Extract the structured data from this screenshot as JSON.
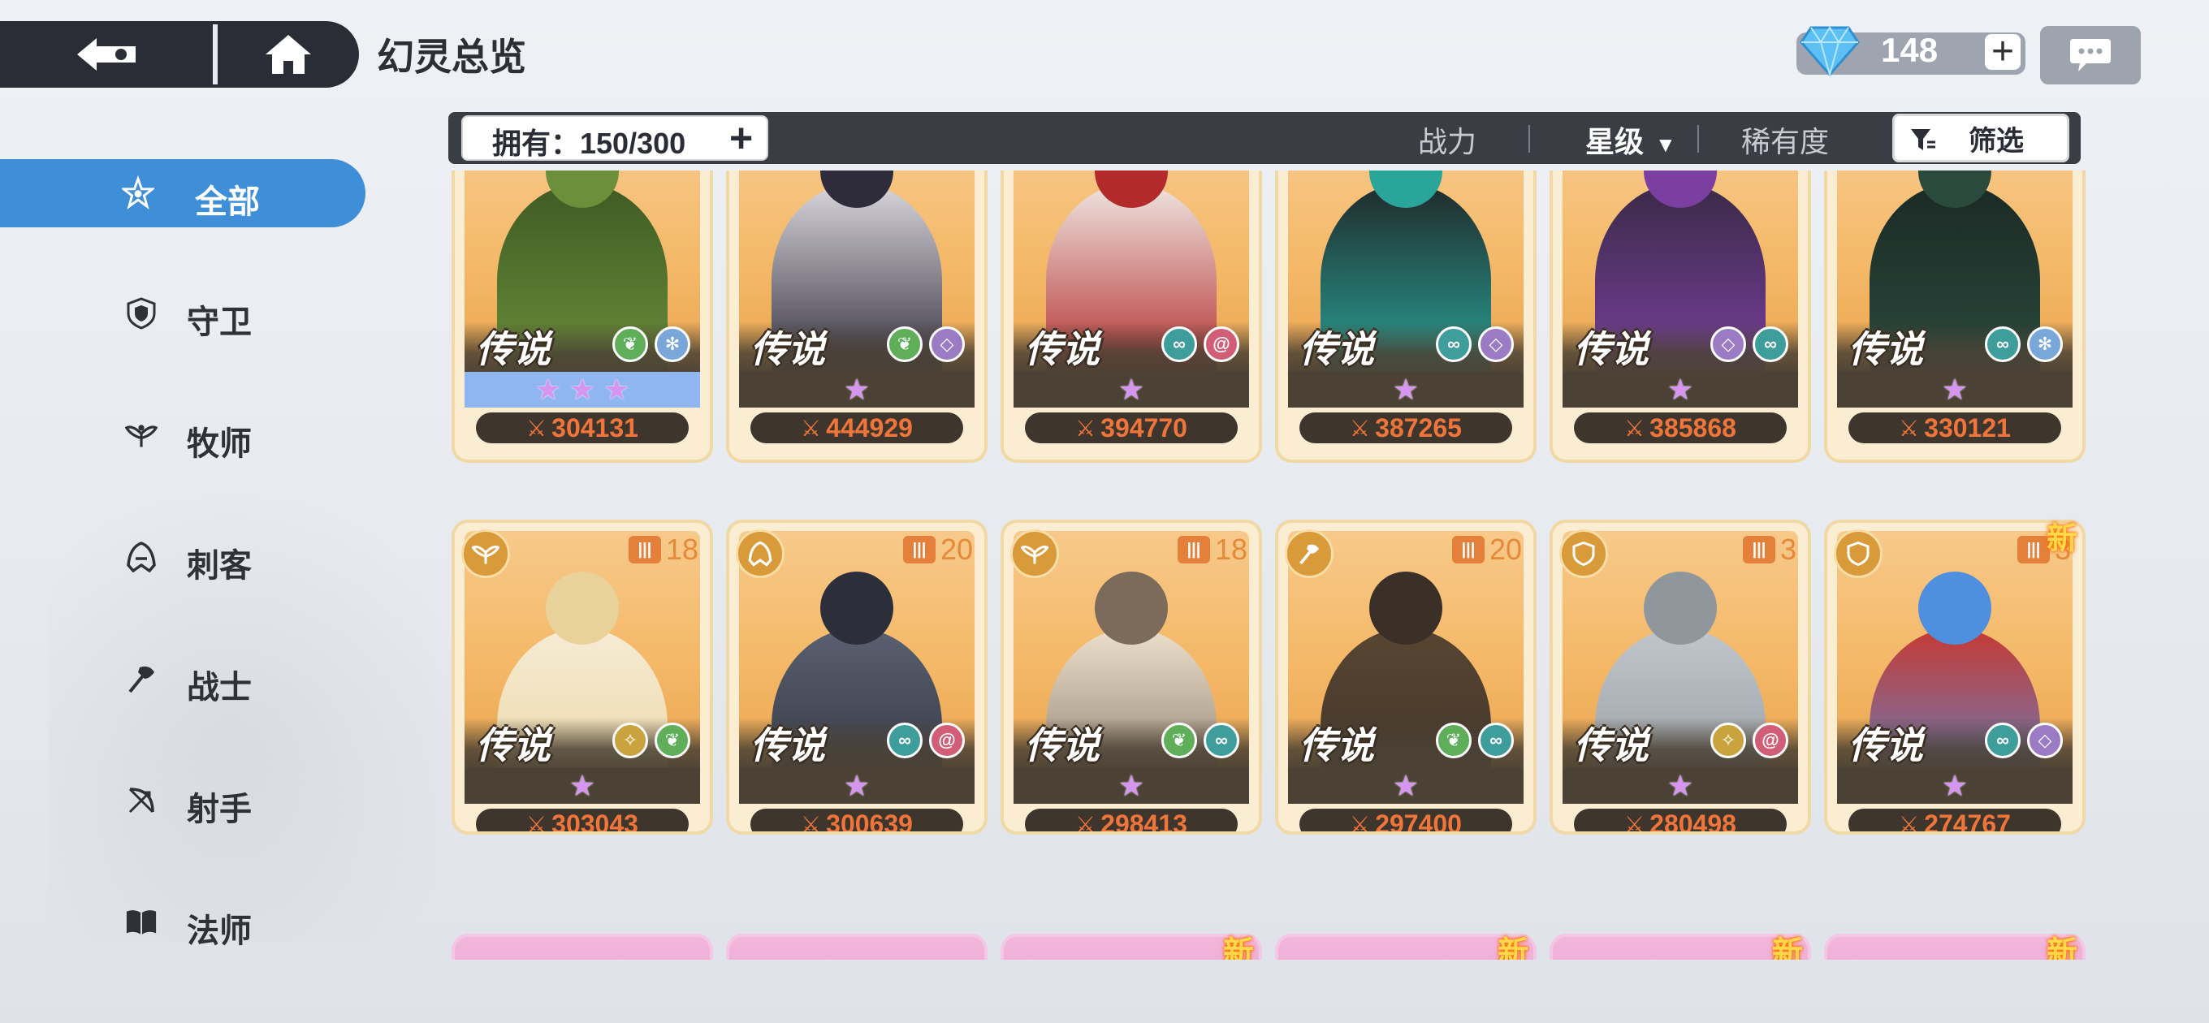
{
  "header": {
    "title": "幻灵总览",
    "currency_value": "148"
  },
  "sidebar": {
    "items": [
      {
        "label": "全部",
        "icon": "all-star-icon",
        "active": true
      },
      {
        "label": "守卫",
        "icon": "guard-shield-icon"
      },
      {
        "label": "牧师",
        "icon": "priest-wing-icon"
      },
      {
        "label": "刺客",
        "icon": "assassin-hood-icon"
      },
      {
        "label": "战士",
        "icon": "warrior-axe-icon"
      },
      {
        "label": "射手",
        "icon": "archer-bow-icon"
      },
      {
        "label": "法师",
        "icon": "mage-book-icon"
      }
    ]
  },
  "toolbar": {
    "owned": "拥有：150/300",
    "sort_power": "战力",
    "sort_star": "星级",
    "sort_rarity": "稀有度",
    "filter": "筛选"
  },
  "row1": [
    {
      "rarity": "传说",
      "power": "304131",
      "stars": 3,
      "elements": [
        "nature",
        "ice"
      ],
      "highlight": true
    },
    {
      "rarity": "传说",
      "power": "444929",
      "stars": 1,
      "elements": [
        "nature",
        "void"
      ]
    },
    {
      "rarity": "传说",
      "power": "394770",
      "stars": 1,
      "elements": [
        "wind",
        "spiral"
      ]
    },
    {
      "rarity": "传说",
      "power": "387265",
      "stars": 1,
      "elements": [
        "wind",
        "void"
      ]
    },
    {
      "rarity": "传说",
      "power": "385868",
      "stars": 1,
      "elements": [
        "void",
        "wind"
      ]
    },
    {
      "rarity": "传说",
      "power": "330121",
      "stars": 1,
      "elements": [
        "wind",
        "ice"
      ]
    }
  ],
  "row2": [
    {
      "rarity": "传说",
      "power": "303043",
      "stars": 1,
      "level": "18",
      "cls": "priest",
      "elements": [
        "light",
        "nature"
      ]
    },
    {
      "rarity": "传说",
      "power": "300639",
      "stars": 1,
      "level": "20",
      "cls": "assassin",
      "elements": [
        "wind",
        "spiral"
      ]
    },
    {
      "rarity": "传说",
      "power": "298413",
      "stars": 1,
      "level": "18",
      "cls": "priest",
      "elements": [
        "nature",
        "wind"
      ]
    },
    {
      "rarity": "传说",
      "power": "297400",
      "stars": 1,
      "level": "20",
      "cls": "warrior",
      "elements": [
        "nature",
        "wind"
      ]
    },
    {
      "rarity": "传说",
      "power": "280498",
      "stars": 1,
      "level": "3",
      "cls": "guard",
      "elements": [
        "light",
        "spiral"
      ]
    },
    {
      "rarity": "传说",
      "power": "274767",
      "stars": 1,
      "level": "3",
      "cls": "guard",
      "elements": [
        "wind",
        "void"
      ],
      "new_label": "新"
    }
  ],
  "row3_new_label": "新",
  "colors": {
    "accent": "#3f8ed8",
    "power": "#f0753a",
    "nature": "#5fae5a",
    "ice": "#7aa7d9",
    "void": "#9b7cc4",
    "wind": "#3e9e9c",
    "spiral": "#d15e76",
    "light": "#c9a33e"
  }
}
